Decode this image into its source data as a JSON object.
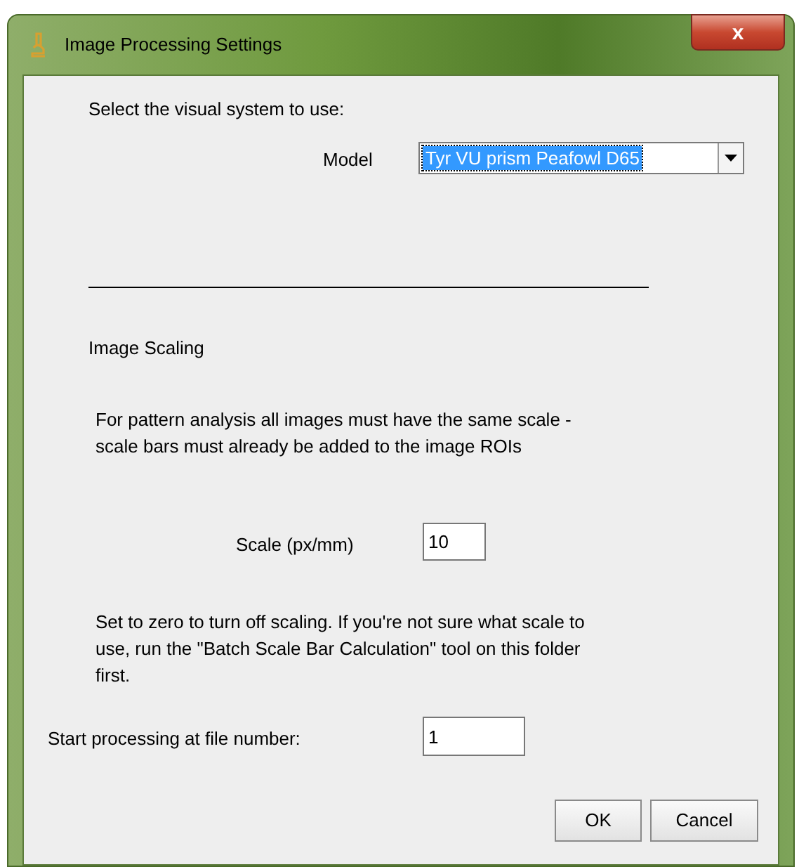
{
  "window": {
    "title": "Image Processing Settings",
    "close": "x"
  },
  "model_prompt": "Select the visual system to use:",
  "model": {
    "label": "Model",
    "value": "Tyr VU prism Peafowl D65",
    "focused": true
  },
  "section_title": "Image Scaling",
  "scaling_note": "For pattern analysis all images must have the same scale - scale bars must already be added to the image ROIs",
  "scale": {
    "label": "Scale (px/mm)",
    "value": "10"
  },
  "zero_note": "Set to zero to turn off scaling. If you're not sure what scale to use, run the \"Batch Scale Bar Calculation\" tool on this folder first.",
  "start": {
    "label": "Start processing at file number:",
    "value": "1"
  },
  "buttons": [
    "OK",
    "Cancel"
  ]
}
